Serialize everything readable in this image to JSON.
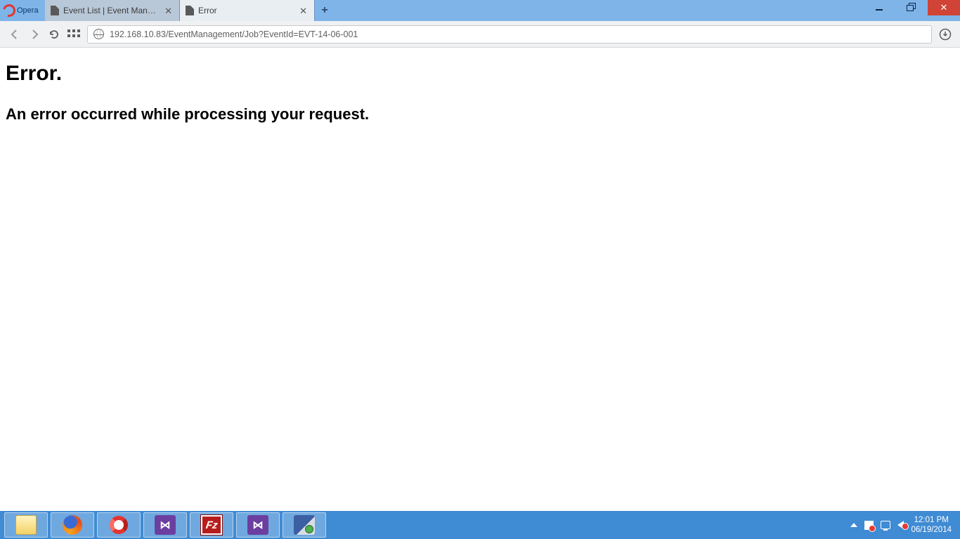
{
  "browser": {
    "name": "Opera",
    "tabs": [
      {
        "title": "Event List | Event Management",
        "active": false
      },
      {
        "title": "Error",
        "active": true
      }
    ],
    "url": "192.168.10.83/EventManagement/Job?EventId=EVT-14-06-001"
  },
  "page": {
    "heading": "Error.",
    "subheading": "An error occurred while processing your request."
  },
  "taskbar": {
    "time": "12:01 PM",
    "date": "06/19/2014"
  }
}
